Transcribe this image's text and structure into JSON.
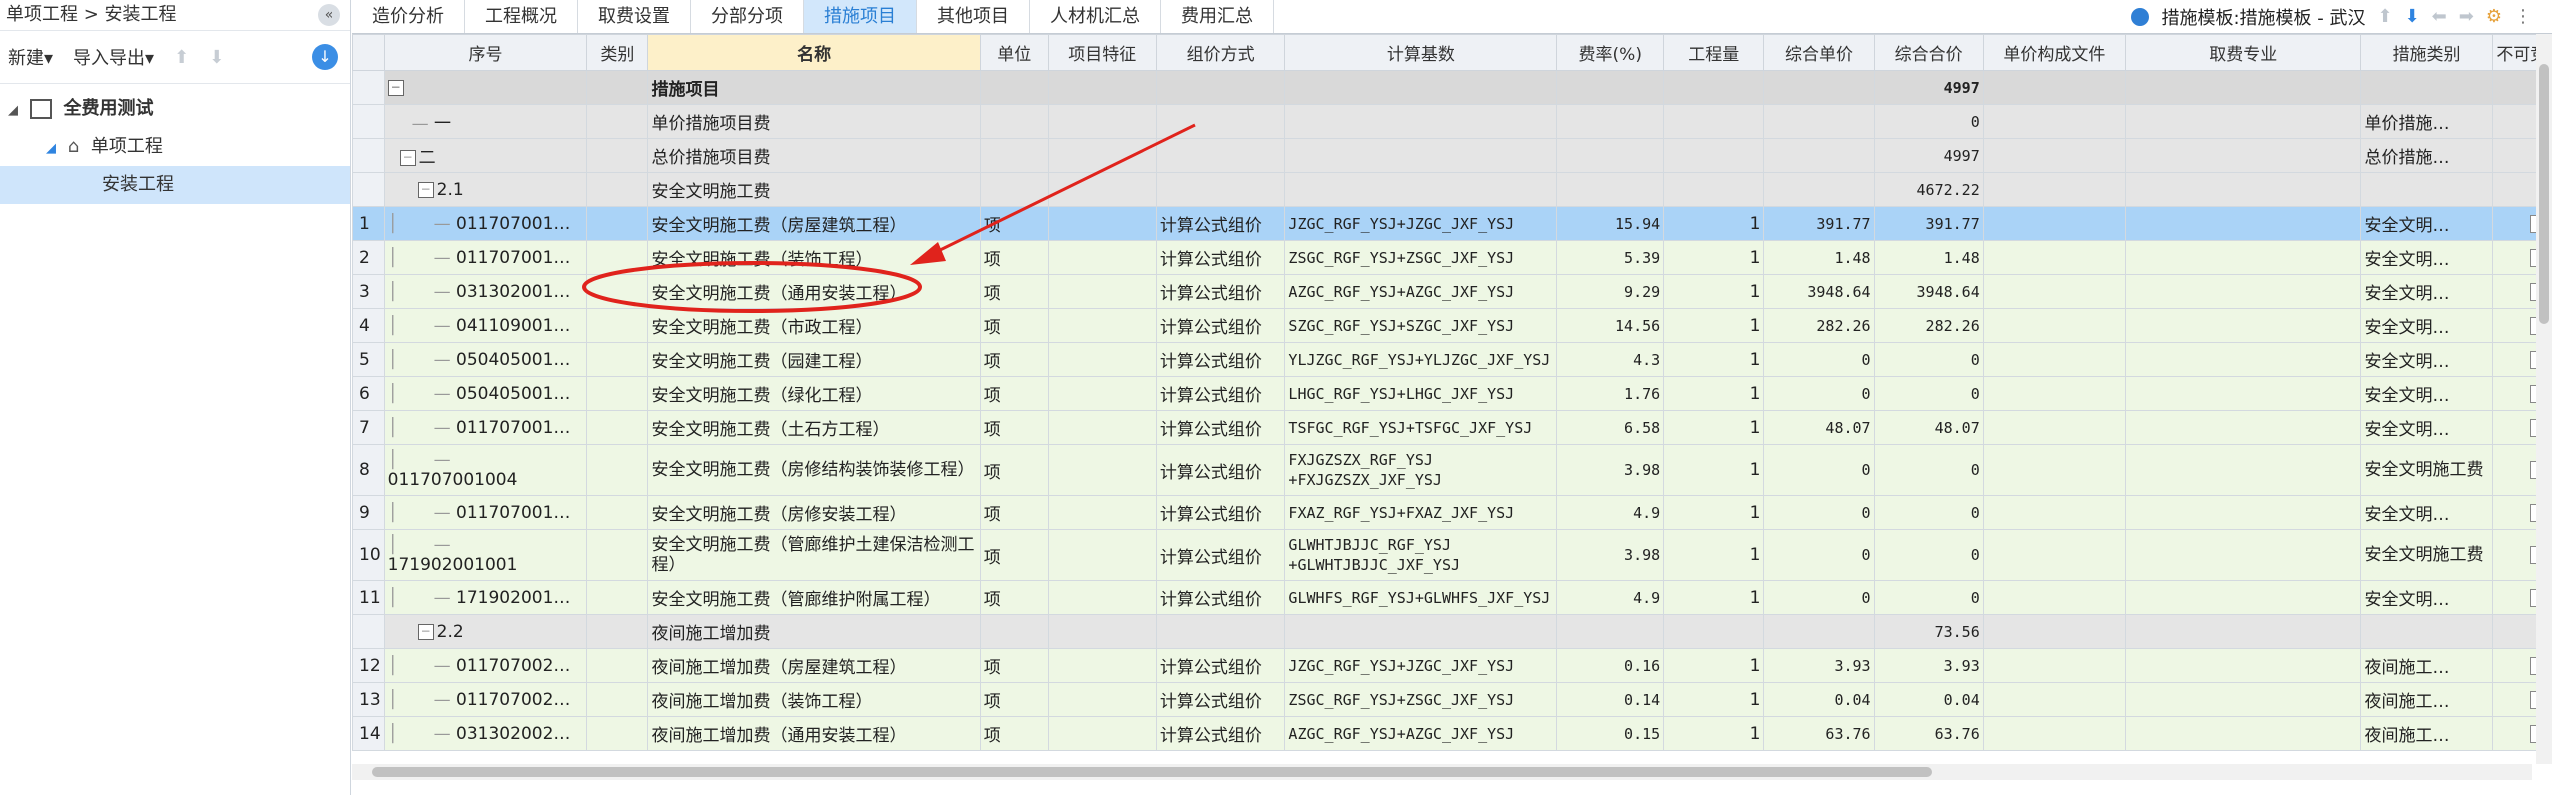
{
  "left": {
    "breadcrumb": "单项工程 > 安装工程",
    "toolbar": {
      "new_label": "新建",
      "import_label": "导入导出"
    },
    "tree": [
      {
        "label": "全费用测试"
      },
      {
        "label": "单项工程"
      },
      {
        "label": "安装工程"
      }
    ]
  },
  "tabs": [
    "造价分析",
    "工程概况",
    "取费设置",
    "分部分项",
    "措施项目",
    "其他项目",
    "人材机汇总",
    "费用汇总"
  ],
  "active_tab": "措施项目",
  "template_label": "措施模板:措施模板 - 武汉",
  "columns": [
    "序号",
    "类别",
    "名称",
    "单位",
    "项目特征",
    "组价方式",
    "计算基数",
    "费率(%)",
    "工程量",
    "综合单价",
    "综合合价",
    "单价构成文件",
    "取费专业",
    "措施类别",
    "不可竞"
  ],
  "rows": [
    {
      "rowno": "",
      "code": "",
      "code_prefix": "",
      "name": "措施项目",
      "unit": "",
      "method": "",
      "base": "",
      "rate": "",
      "qty": "",
      "price": "",
      "total": "4997",
      "category": "",
      "style": "top"
    },
    {
      "rowno": "",
      "code": "一",
      "code_prefix": "",
      "name": "单价措施项目费",
      "unit": "",
      "method": "",
      "base": "",
      "rate": "",
      "qty": "",
      "price": "",
      "total": "0",
      "category": "单价措施…",
      "style": "gray"
    },
    {
      "rowno": "",
      "code": "二",
      "code_prefix": "box",
      "name": "总价措施项目费",
      "unit": "",
      "method": "",
      "base": "",
      "rate": "",
      "qty": "",
      "price": "",
      "total": "4997",
      "category": "总价措施…",
      "style": "gray"
    },
    {
      "rowno": "",
      "code": "2.1",
      "code_prefix": "box",
      "name": "安全文明施工费",
      "unit": "",
      "method": "",
      "base": "",
      "rate": "",
      "qty": "",
      "price": "",
      "total": "4672.22",
      "category": "",
      "style": "gray"
    },
    {
      "rowno": "1",
      "code": "011707001…",
      "code_prefix": "",
      "name": "安全文明施工费（房屋建筑工程）",
      "unit": "项",
      "method": "计算公式组价",
      "base": "JZGC_RGF_YSJ+JZGC_JXF_YSJ",
      "rate": "15.94",
      "qty": "1",
      "price": "391.77",
      "total": "391.77",
      "category": "安全文明…",
      "style": "sel"
    },
    {
      "rowno": "2",
      "code": "011707001…",
      "code_prefix": "",
      "name": "安全文明施工费（装饰工程）",
      "unit": "项",
      "method": "计算公式组价",
      "base": "ZSGC_RGF_YSJ+ZSGC_JXF_YSJ",
      "rate": "5.39",
      "qty": "1",
      "price": "1.48",
      "total": "1.48",
      "category": "安全文明…",
      "style": "green"
    },
    {
      "rowno": "3",
      "code": "031302001…",
      "code_prefix": "",
      "name": "安全文明施工费（通用安装工程）",
      "unit": "项",
      "method": "计算公式组价",
      "base": "AZGC_RGF_YSJ+AZGC_JXF_YSJ",
      "rate": "9.29",
      "qty": "1",
      "price": "3948.64",
      "total": "3948.64",
      "category": "安全文明…",
      "style": "green"
    },
    {
      "rowno": "4",
      "code": "041109001…",
      "code_prefix": "",
      "name": "安全文明施工费（市政工程）",
      "unit": "项",
      "method": "计算公式组价",
      "base": "SZGC_RGF_YSJ+SZGC_JXF_YSJ",
      "rate": "14.56",
      "qty": "1",
      "price": "282.26",
      "total": "282.26",
      "category": "安全文明…",
      "style": "green"
    },
    {
      "rowno": "5",
      "code": "050405001…",
      "code_prefix": "",
      "name": "安全文明施工费（园建工程）",
      "unit": "项",
      "method": "计算公式组价",
      "base": "YLJZGC_RGF_YSJ+YLJZGC_JXF_YSJ",
      "rate": "4.3",
      "qty": "1",
      "price": "0",
      "total": "0",
      "category": "安全文明…",
      "style": "green"
    },
    {
      "rowno": "6",
      "code": "050405001…",
      "code_prefix": "",
      "name": "安全文明施工费（绿化工程）",
      "unit": "项",
      "method": "计算公式组价",
      "base": "LHGC_RGF_YSJ+LHGC_JXF_YSJ",
      "rate": "1.76",
      "qty": "1",
      "price": "0",
      "total": "0",
      "category": "安全文明…",
      "style": "green"
    },
    {
      "rowno": "7",
      "code": "011707001…",
      "code_prefix": "",
      "name": "安全文明施工费（土石方工程）",
      "unit": "项",
      "method": "计算公式组价",
      "base": "TSFGC_RGF_YSJ+TSFGC_JXF_YSJ",
      "rate": "6.58",
      "qty": "1",
      "price": "48.07",
      "total": "48.07",
      "category": "安全文明…",
      "style": "green"
    },
    {
      "rowno": "8",
      "code": "011707001004",
      "code_prefix": "",
      "name": "安全文明施工费（房修结构装饰装修工程）",
      "unit": "项",
      "method": "计算公式组价",
      "base": "FXJGZSZX_RGF_YSJ +FXJGZSZX_JXF_YSJ",
      "rate": "3.98",
      "qty": "1",
      "price": "0",
      "total": "0",
      "category": "安全文明施工费",
      "style": "green",
      "tall": true
    },
    {
      "rowno": "9",
      "code": "011707001…",
      "code_prefix": "",
      "name": "安全文明施工费（房修安装工程）",
      "unit": "项",
      "method": "计算公式组价",
      "base": "FXAZ_RGF_YSJ+FXAZ_JXF_YSJ",
      "rate": "4.9",
      "qty": "1",
      "price": "0",
      "total": "0",
      "category": "安全文明…",
      "style": "green"
    },
    {
      "rowno": "10",
      "code": "171902001001",
      "code_prefix": "",
      "name": "安全文明施工费（管廊维护土建保洁检测工程）",
      "unit": "项",
      "method": "计算公式组价",
      "base": "GLWHTJBJJC_RGF_YSJ +GLWHTJBJJC_JXF_YSJ",
      "rate": "3.98",
      "qty": "1",
      "price": "0",
      "total": "0",
      "category": "安全文明施工费",
      "style": "green",
      "tall": true
    },
    {
      "rowno": "11",
      "code": "171902001…",
      "code_prefix": "",
      "name": "安全文明施工费（管廊维护附属工程）",
      "unit": "项",
      "method": "计算公式组价",
      "base": "GLWHFS_RGF_YSJ+GLWHFS_JXF_YSJ",
      "rate": "4.9",
      "qty": "1",
      "price": "0",
      "total": "0",
      "category": "安全文明…",
      "style": "green"
    },
    {
      "rowno": "",
      "code": "2.2",
      "code_prefix": "box",
      "name": "夜间施工增加费",
      "unit": "",
      "method": "",
      "base": "",
      "rate": "",
      "qty": "",
      "price": "",
      "total": "73.56",
      "category": "",
      "style": "gray"
    },
    {
      "rowno": "12",
      "code": "011707002…",
      "code_prefix": "",
      "name": "夜间施工增加费（房屋建筑工程）",
      "unit": "项",
      "method": "计算公式组价",
      "base": "JZGC_RGF_YSJ+JZGC_JXF_YSJ",
      "rate": "0.16",
      "qty": "1",
      "price": "3.93",
      "total": "3.93",
      "category": "夜间施工…",
      "style": "green"
    },
    {
      "rowno": "13",
      "code": "011707002…",
      "code_prefix": "",
      "name": "夜间施工增加费（装饰工程）",
      "unit": "项",
      "method": "计算公式组价",
      "base": "ZSGC_RGF_YSJ+ZSGC_JXF_YSJ",
      "rate": "0.14",
      "qty": "1",
      "price": "0.04",
      "total": "0.04",
      "category": "夜间施工…",
      "style": "green"
    },
    {
      "rowno": "14",
      "code": "031302002…",
      "code_prefix": "",
      "name": "夜间施工增加费（通用安装工程）",
      "unit": "项",
      "method": "计算公式组价",
      "base": "AZGC_RGF_YSJ+AZGC_JXF_YSJ",
      "rate": "0.15",
      "qty": "1",
      "price": "63.76",
      "total": "63.76",
      "category": "夜间施工…",
      "style": "green"
    }
  ],
  "colors": {
    "active_tab": "#d2e7fb",
    "selected_row": "#aad3f7",
    "annotation": "#e0231c"
  }
}
